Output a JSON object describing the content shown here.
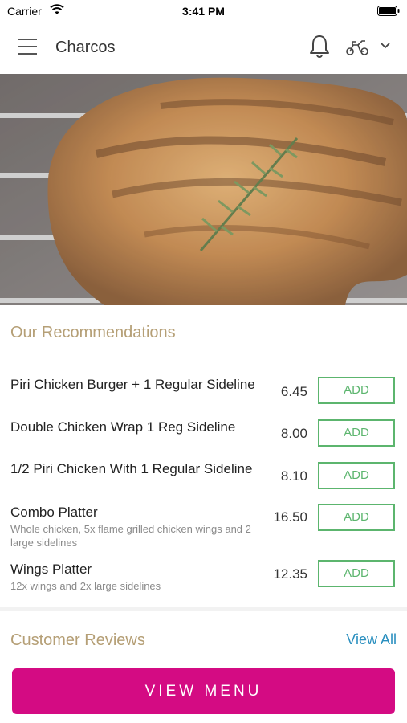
{
  "status_bar": {
    "carrier": "Carrier",
    "time": "3:41 PM"
  },
  "header": {
    "title": "Charcos"
  },
  "recommendations": {
    "title": "Our Recommendations",
    "items": [
      {
        "name": "Piri Chicken Burger + 1 Regular Sideline",
        "description": "",
        "price": "6.45",
        "add_label": "ADD"
      },
      {
        "name": "Double Chicken Wrap 1 Reg Sideline",
        "description": "",
        "price": "8.00",
        "add_label": "ADD"
      },
      {
        "name": "1/2 Piri Chicken With 1 Regular Sideline",
        "description": "",
        "price": "8.10",
        "add_label": "ADD"
      },
      {
        "name": "Combo Platter",
        "description": "Whole chicken, 5x flame grilled chicken wings and 2 large sidelines",
        "price": "16.50",
        "add_label": "ADD"
      },
      {
        "name": "Wings Platter",
        "description": "12x wings and 2x large sidelines",
        "price": "12.35",
        "add_label": "ADD"
      }
    ]
  },
  "reviews": {
    "title": "Customer Reviews",
    "view_all_label": "View All"
  },
  "footer": {
    "view_menu_label": "VIEW MENU"
  },
  "icons": {
    "menu": "hamburger-menu-icon",
    "notifications": "bell-icon",
    "delivery_mode": "scooter-icon",
    "dropdown": "chevron-down-icon"
  },
  "colors": {
    "accent_gold": "#b59f76",
    "add_green": "#5cb56e",
    "view_all_blue": "#2a8fbf",
    "primary_magenta": "#d40b83"
  }
}
